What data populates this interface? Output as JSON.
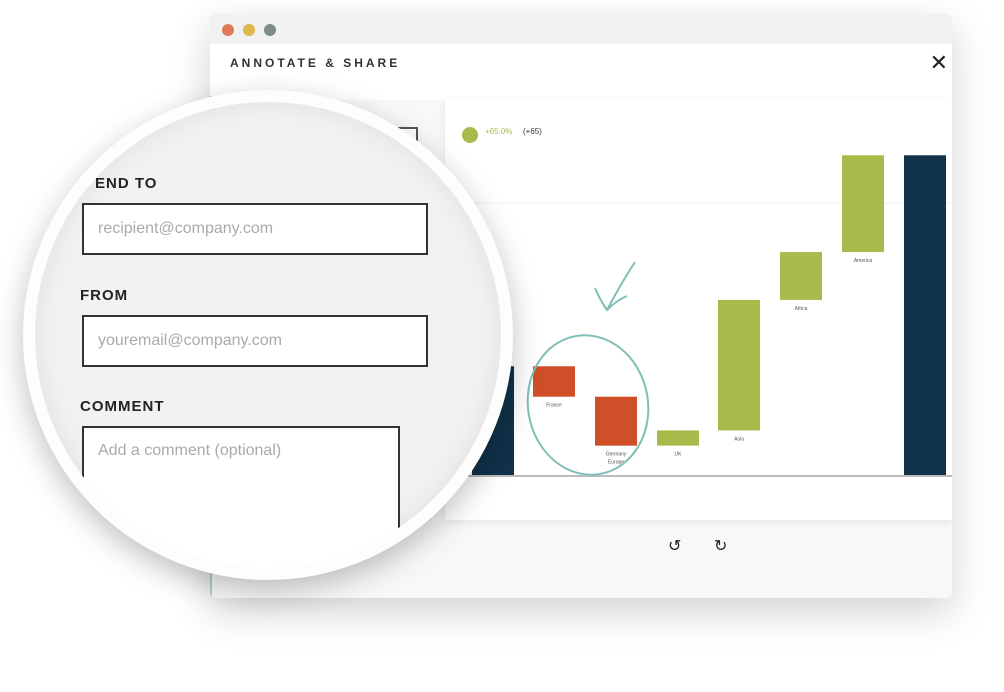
{
  "window": {
    "title": "ANNOTATE & SHARE",
    "close_icon": "close-icon",
    "traffic_lights": [
      "#e07b5a",
      "#e0b84a",
      "#7c8c88"
    ]
  },
  "form": {
    "send_to_label": "END TO",
    "send_to_placeholder": "recipient@company.com",
    "from_label": "FROM",
    "from_placeholder": "youremail@company.com",
    "comment_label": "COMMENT",
    "comment_placeholder": "Add a comment (optional)"
  },
  "toolbar": {
    "undo_icon": "undo-icon",
    "redo_icon": "redo-icon"
  },
  "chart_data": {
    "type": "bar",
    "subtype": "waterfall",
    "kpi": {
      "change_pct": "+65.0%",
      "change_abs": "(+65)"
    },
    "categories": [
      "",
      "France",
      "Germany Europe",
      "UK",
      "Asia",
      "Africa",
      "America",
      ""
    ],
    "bars": [
      {
        "kind": "total",
        "start": 0,
        "end": 100
      },
      {
        "kind": "delta",
        "start": 100,
        "end": 72
      },
      {
        "kind": "delta",
        "start": 72,
        "end": 27
      },
      {
        "kind": "delta",
        "start": 27,
        "end": 41
      },
      {
        "kind": "delta",
        "start": 41,
        "end": 161
      },
      {
        "kind": "delta",
        "start": 161,
        "end": 205
      },
      {
        "kind": "delta",
        "start": 205,
        "end": 294
      },
      {
        "kind": "total",
        "start": 0,
        "end": 294
      }
    ],
    "ylim": [
      0,
      320
    ],
    "colors": {
      "total": "#10324a",
      "increase": "#a8bb4a",
      "decrease": "#cf4f28",
      "annotation": "#7fbfb6"
    }
  }
}
